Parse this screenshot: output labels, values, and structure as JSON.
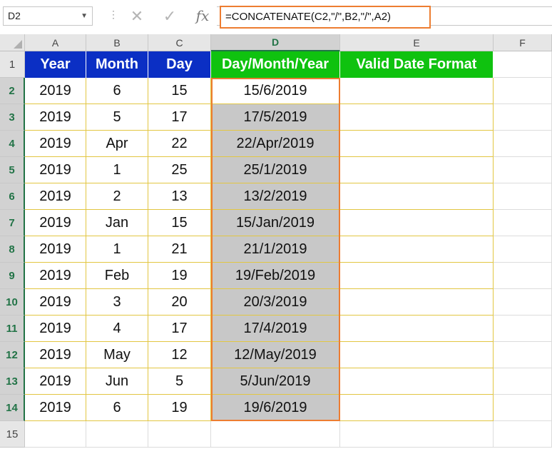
{
  "name_box": "D2",
  "formula_bar": {
    "cancel_icon": "x-icon",
    "enter_icon": "check-icon",
    "fx_label": "fx",
    "formula": "=CONCATENATE(C2,\"/\",B2,\"/\",A2)"
  },
  "columns": [
    "A",
    "B",
    "C",
    "D",
    "E",
    "F"
  ],
  "selected_column": "D",
  "header_row": [
    "Year",
    "Month",
    "Day",
    "Day/Month/Year",
    "Valid Date Format"
  ],
  "rows": [
    {
      "num": "2",
      "year": "2019",
      "month": "6",
      "day": "15",
      "dmy": "15/6/2019"
    },
    {
      "num": "3",
      "year": "2019",
      "month": "5",
      "day": "17",
      "dmy": "17/5/2019"
    },
    {
      "num": "4",
      "year": "2019",
      "month": "Apr",
      "day": "22",
      "dmy": "22/Apr/2019"
    },
    {
      "num": "5",
      "year": "2019",
      "month": "1",
      "day": "25",
      "dmy": "25/1/2019"
    },
    {
      "num": "6",
      "year": "2019",
      "month": "2",
      "day": "13",
      "dmy": "13/2/2019"
    },
    {
      "num": "7",
      "year": "2019",
      "month": "Jan",
      "day": "15",
      "dmy": "15/Jan/2019"
    },
    {
      "num": "8",
      "year": "2019",
      "month": "1",
      "day": "21",
      "dmy": "21/1/2019"
    },
    {
      "num": "9",
      "year": "2019",
      "month": "Feb",
      "day": "19",
      "dmy": "19/Feb/2019"
    },
    {
      "num": "10",
      "year": "2019",
      "month": "3",
      "day": "20",
      "dmy": "20/3/2019"
    },
    {
      "num": "11",
      "year": "2019",
      "month": "4",
      "day": "17",
      "dmy": "17/4/2019"
    },
    {
      "num": "12",
      "year": "2019",
      "month": "May",
      "day": "12",
      "dmy": "12/May/2019"
    },
    {
      "num": "13",
      "year": "2019",
      "month": "Jun",
      "day": "5",
      "dmy": "5/Jun/2019"
    },
    {
      "num": "14",
      "year": "2019",
      "month": "6",
      "day": "19",
      "dmy": "19/6/2019"
    }
  ],
  "row_labels": {
    "header": "1",
    "last": "15"
  },
  "colors": {
    "header_blue": "#0B2FC4",
    "header_green": "#0FC20F",
    "highlight_orange": "#ED7D31",
    "selection_gray": "#C8C8C8",
    "excel_green": "#217346"
  }
}
